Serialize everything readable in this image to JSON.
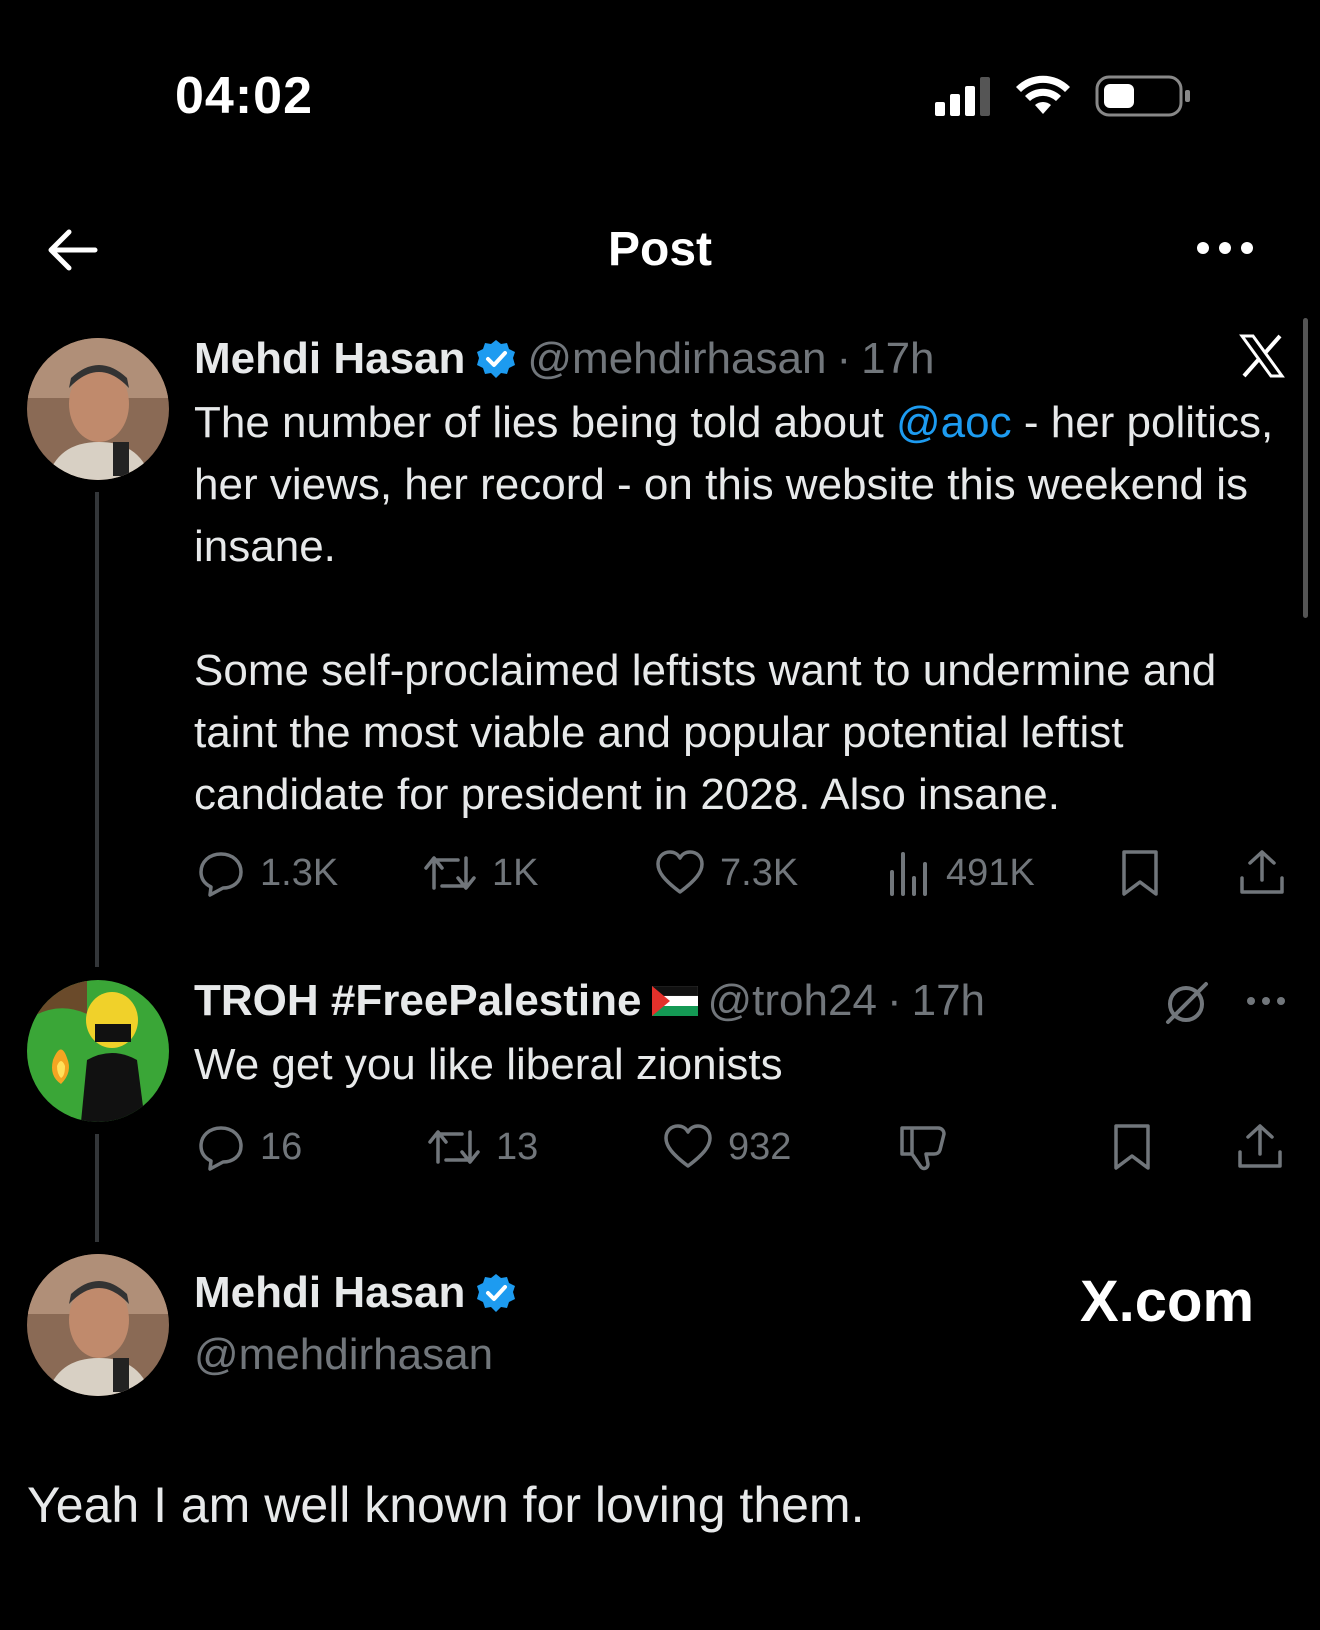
{
  "status_bar": {
    "time": "04:02"
  },
  "nav": {
    "title": "Post"
  },
  "tweet1": {
    "name": "Mehdi Hasan",
    "handle": "@mehdirhasan",
    "time": "17h",
    "text_before": "The number of lies being told about ",
    "mention": "@aoc",
    "text_after": " - her politics, her views, her record - on this website this weekend is insane.\n\nSome self-proclaimed leftists want to undermine and taint the most viable and popular potential leftist candidate for president in 2028. Also insane.",
    "replies": "1.3K",
    "reposts": "1K",
    "likes": "7.3K",
    "views": "491K"
  },
  "tweet2": {
    "name": "TROH #FreePalestine",
    "handle": "@troh24",
    "time": "17h",
    "text": "We get you like liberal zionists",
    "replies": "16",
    "reposts": "13",
    "likes": "932"
  },
  "tweet3": {
    "name": "Mehdi Hasan",
    "handle": "@mehdirhasan",
    "brand": "X.com",
    "text": "Yeah I am well known for loving them."
  },
  "separator": "·"
}
